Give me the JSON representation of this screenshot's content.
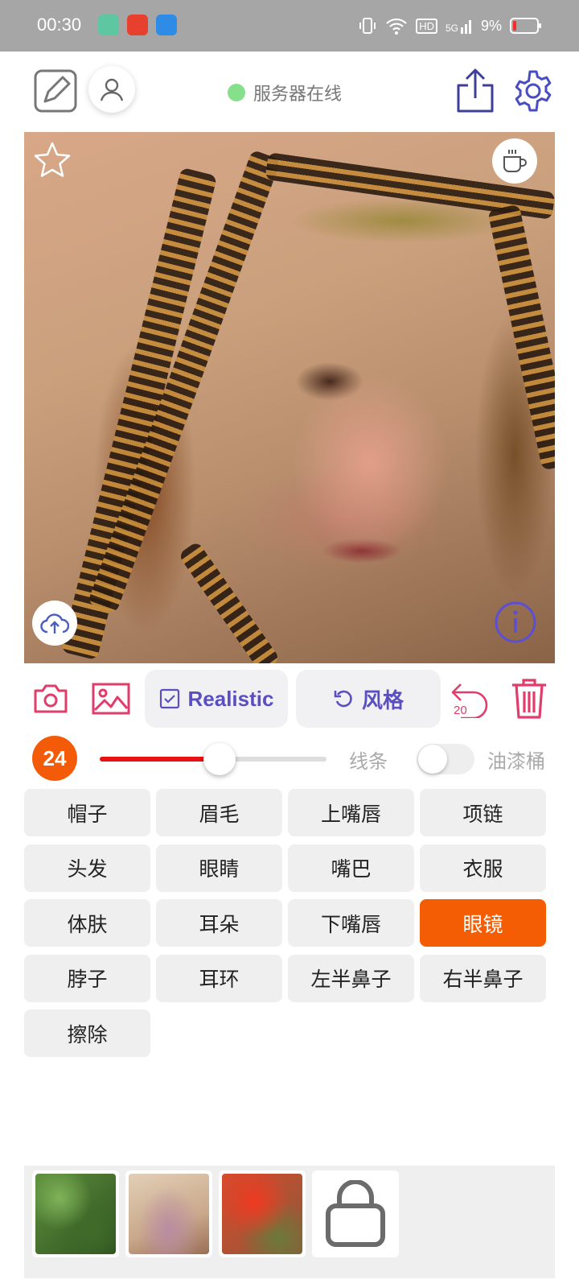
{
  "status_bar": {
    "time": "00:30",
    "battery": "9%",
    "hd_label": "HD",
    "net_label": "5G"
  },
  "header": {
    "server_status": "服务器在线",
    "server_status_color": "#86e08b"
  },
  "toolbar": {
    "mode_label": "Realistic",
    "style_label": "风格",
    "undo_count": "20",
    "accent_color": "#e23d6a",
    "purple_color": "#5a4fc0"
  },
  "brush": {
    "size": "24",
    "slider_fraction": 0.53,
    "line_label": "线条",
    "bucket_label": "油漆桶",
    "bucket_enabled": false
  },
  "parts": {
    "items": [
      "帽子",
      "眉毛",
      "上嘴唇",
      "项链",
      "头发",
      "眼睛",
      "嘴巴",
      "衣服",
      "体肤",
      "耳朵",
      "下嘴唇",
      "眼镜",
      "脖子",
      "耳环",
      "左半鼻子",
      "右半鼻子",
      "擦除"
    ],
    "selected": "眼镜",
    "selected_color": "#f55d05"
  },
  "gallery": {
    "thumbnails": [
      "green-foliage",
      "beige-pink",
      "red-flowers"
    ],
    "store_icon": "shopping-bag-icon"
  }
}
